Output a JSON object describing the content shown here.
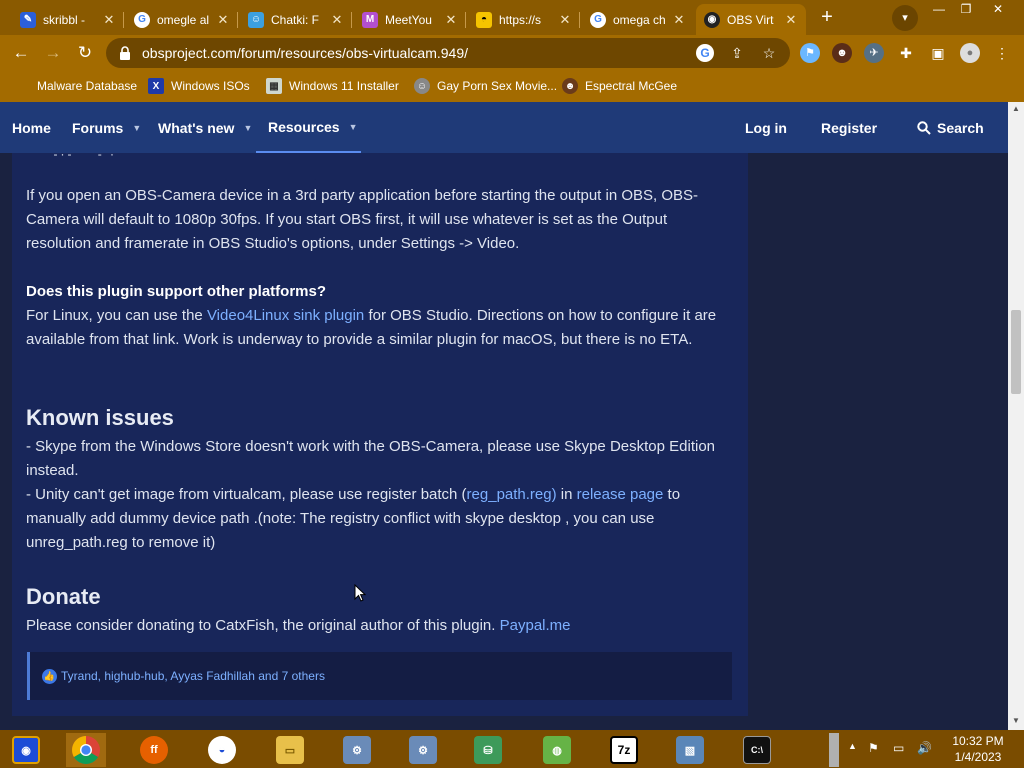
{
  "browser": {
    "tabs": [
      {
        "title": "skribbl - ",
        "icon": "skribbl-favicon",
        "color": "#2b5fd9"
      },
      {
        "title": "omegle al",
        "icon": "google-favicon",
        "color": "#ffffff"
      },
      {
        "title": "Chatki: F",
        "icon": "chatki-favicon",
        "color": "#3ca0e0"
      },
      {
        "title": "MeetYou",
        "icon": "meetyou-favicon",
        "color": "#b34fd1"
      },
      {
        "title": "https://s",
        "icon": "mask-favicon",
        "color": "#f5c400"
      },
      {
        "title": "omega ch",
        "icon": "google-favicon",
        "color": "#ffffff"
      },
      {
        "title": "OBS Virt",
        "icon": "obs-favicon",
        "color": "#222222"
      }
    ],
    "active_tab": 6,
    "url": "obsproject.com/forum/resources/obs-virtualcam.949/",
    "bookmarks": [
      {
        "label": "Malware Database",
        "icon": "globe-icon"
      },
      {
        "label": "Windows ISOs",
        "icon": "x-icon"
      },
      {
        "label": "Windows 11 Installer",
        "icon": "image-icon"
      },
      {
        "label": "Gay Porn Sex Movie...",
        "icon": "face-icon"
      },
      {
        "label": "Espectral McGee",
        "icon": "avatar-icon"
      }
    ],
    "theme_color": "#a36b00"
  },
  "nav": {
    "home": "Home",
    "forums": "Forums",
    "whats_new": "What's new",
    "resources": "Resources",
    "login": "Log in",
    "register": "Register",
    "search": "Search"
  },
  "content": {
    "para1": "If you open an OBS-Camera device in a 3rd party application before starting the output in OBS, OBS-Camera will default to 1080p 30fps. If you start OBS first, it will use whatever is set as the Output resolution and framerate in OBS Studio's options, under Settings -> Video.",
    "faq_question": "Does this plugin support other platforms?",
    "faq_answer_pre": "For Linux, you can use the ",
    "faq_answer_link": "Video4Linux sink plugin",
    "faq_answer_post": " for OBS Studio. Directions on how to configure it are available from that link. Work is underway to provide a similar plugin for macOS, but there is no ETA.",
    "known_issues_heading": "Known issues",
    "issue1": "- Skype from the Windows Store doesn't work with the OBS-Camera, please use Skype Desktop Edition instead.",
    "issue2_pre": "- Unity can't get image from virtualcam, please use register batch (",
    "issue2_link1": "reg_path.reg)",
    "issue2_mid": " in ",
    "issue2_link2": "release page",
    "issue2_post": " to manually add dummy device path .(note: The registry conflict with skype desktop , you can use unreg_path.reg to remove it)",
    "donate_heading": "Donate",
    "donate_pre": "Please consider donating to CatxFish, the original author of this plugin. ",
    "donate_link": "Paypal.me",
    "reactions": "Tyrand, highub-hub, Ayyas Fadhillah and 7 others"
  },
  "taskbar": {
    "time": "10:32 PM",
    "date": "1/4/2023",
    "apps": [
      "winamp-icon",
      "chrome-icon",
      "firefox-icon",
      "obama-icon",
      "folder-icon",
      "installer-icon",
      "installer-icon",
      "network-icon",
      "drive-icon",
      "7zip-icon",
      "photo-icon",
      "terminal-icon"
    ]
  }
}
